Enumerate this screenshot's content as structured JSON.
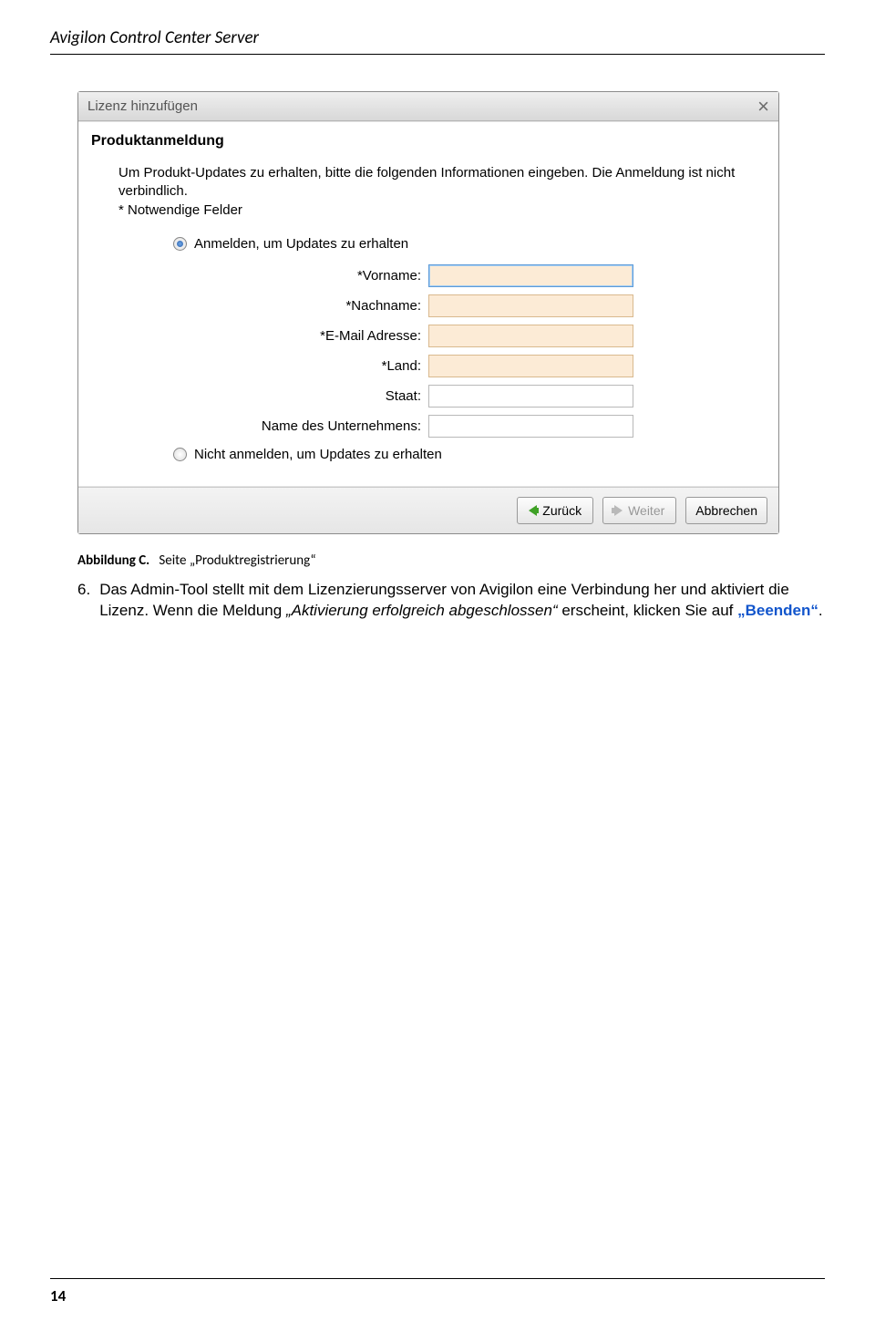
{
  "doc": {
    "header": "Avigilon Control Center Server",
    "page_number": "14"
  },
  "dialog": {
    "title": "Lizenz hinzufügen",
    "section_head": "Produktanmeldung",
    "intro_line1": "Um Produkt-Updates zu erhalten, bitte die folgenden Informationen eingeben.  Die Anmeldung ist nicht verbindlich.",
    "intro_line2": "* Notwendige Felder",
    "radio_signup": "Anmelden, um Updates zu erhalten",
    "radio_nosignup": "Nicht anmelden, um Updates zu erhalten",
    "fields": {
      "vorname": "*Vorname:",
      "nachname": "*Nachname:",
      "email": "*E-Mail Adresse:",
      "land": "*Land:",
      "staat": "Staat:",
      "firma": "Name des Unternehmens:"
    },
    "buttons": {
      "back": "Zurück",
      "next": "Weiter",
      "cancel": "Abbrechen"
    }
  },
  "caption": {
    "label": "Abbildung C.",
    "text": "Seite „Produktregistrierung“"
  },
  "para": {
    "num": "6.",
    "pre": "Das Admin-Tool stellt mit dem Lizenzierungsserver von Avigilon eine Verbindung her und aktiviert die Lizenz. Wenn die Meldung ",
    "italic": "„Aktivierung erfolgreich abgeschlossen“",
    "mid": " erscheint, klicken Sie auf ",
    "button_ref": "„Beenden“",
    "post": "."
  }
}
